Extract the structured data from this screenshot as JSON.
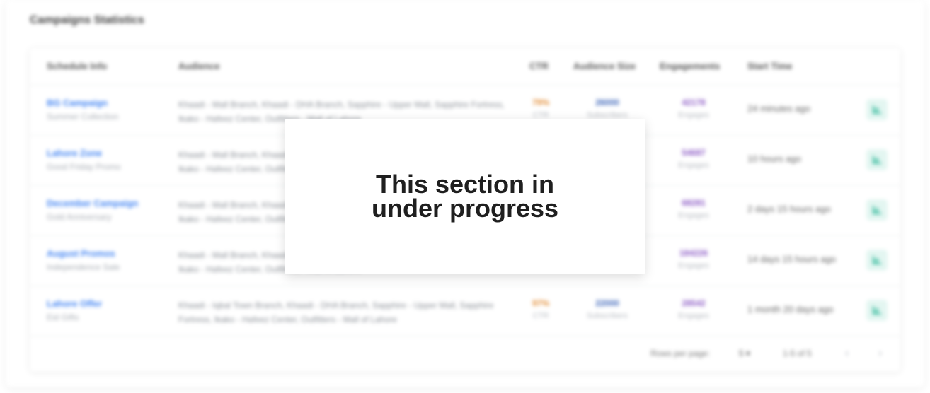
{
  "section_title": "Campaigns Statistics",
  "table": {
    "columns": [
      "Schedule Info",
      "Audience",
      "CTR",
      "Audience Size",
      "Engagements",
      "Start Time"
    ],
    "rows": [
      {
        "name": "BG Campaign",
        "subtitle": "Summer Collection",
        "audience": "Khaadi - Mall Branch, Khaadi - DHA Branch, Sapphire - Upper Mall, Sapphire Fortress, Ikako - Hafeez Center, Outfitters - Mall of Lahore",
        "ctr": "79%",
        "ctr_label": "CTR",
        "audience_size": "26000",
        "size_label": "Subscribers",
        "engagements": "42178",
        "eng_label": "Engages",
        "start_time": "24 minutes ago"
      },
      {
        "name": "Lahore Zone",
        "subtitle": "Good Friday Promo",
        "audience": "Khaadi - Mall Branch, Khaadi - DHA Branch, Sapphire - Upper Mall, Sapphire Fortress, Ikako - Hafeez Center, Outfitters - Mall of Lahore",
        "ctr": "",
        "ctr_label": "",
        "audience_size": "",
        "size_label": "",
        "engagements": "54687",
        "eng_label": "Engages",
        "start_time": "10 hours ago"
      },
      {
        "name": "December Campaign",
        "subtitle": "Gold Anniversary",
        "audience": "Khaadi - Mall Branch, Khaadi - DHA Branch, Sapphire - Upper Mall, Sapphire Fortress, Ikako - Hafeez Center, Outfitters - Mall of Lahore",
        "ctr": "",
        "ctr_label": "",
        "audience_size": "",
        "size_label": "",
        "engagements": "68281",
        "eng_label": "Engages",
        "start_time": "2 days 15 hours ago"
      },
      {
        "name": "August Promos",
        "subtitle": "Independence Sale",
        "audience": "Khaadi - Mall Branch, Khaadi - DHA Branch, Sapphire - Upper Mall, Sapphire Fortress, Ikako - Hafeez Center, Outfitters - Mall of Lahore",
        "ctr": "",
        "ctr_label": "",
        "audience_size": "",
        "size_label": "",
        "engagements": "184226",
        "eng_label": "Engages",
        "start_time": "14 days 15 hours ago"
      },
      {
        "name": "Lahore Offer",
        "subtitle": "Eid Gifts",
        "audience": "Khaadi - Iqbal Town Branch, Khaadi - DHA Branch, Sapphire - Upper Mall, Sapphire Fortress, Ikako - Hafeez Center, Outfitters - Mall of Lahore",
        "ctr": "97%",
        "ctr_label": "CTR",
        "audience_size": "22000",
        "size_label": "Subscribers",
        "engagements": "28542",
        "eng_label": "Engages",
        "start_time": "1 month 20 days ago"
      }
    ]
  },
  "pagination": {
    "rows_per_page_label": "Rows per page:",
    "rows_per_page_value": "5",
    "range": "1-5 of 5",
    "prev_icon": "chevron-left-icon",
    "next_icon": "chevron-right-icon"
  },
  "overlay": {
    "message": "This section in under progress"
  },
  "colors": {
    "link": "#3f82f2",
    "ctr": "#e28b33",
    "size": "#3a63b8",
    "engagement": "#8a58c4",
    "action_bg": "#e3f6f1",
    "action_icon": "#2fb89a"
  }
}
